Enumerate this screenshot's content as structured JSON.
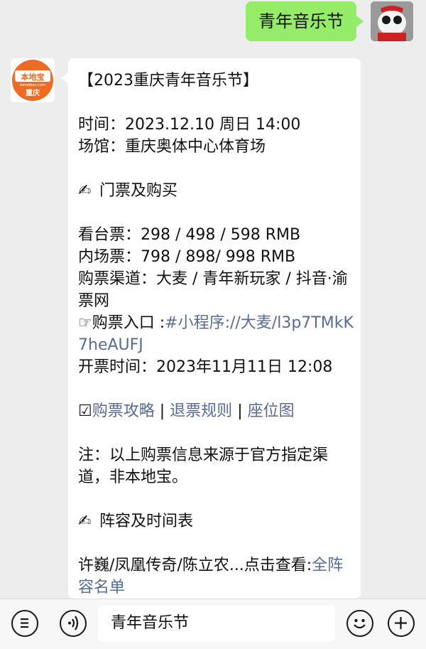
{
  "chat": {
    "outgoing_text": "青年音乐节",
    "bot_logo_text": "本地宝",
    "bot_logo_sub": "bendibao.com",
    "bot_logo_city": "重庆",
    "lines": {
      "title": "【2023重庆青年音乐节】",
      "time": "时间：2023.12.10 周日 14:00",
      "venue": "场馆：重庆奥体中心体育场",
      "tickets_heading": "门票及购买",
      "stand": "看台票：298 / 498 / 598 RMB",
      "floor": "内场票：798 / 898/ 998 RMB",
      "channels": "购票渠道：大麦 / 青年新玩家 / 抖音·渝票网",
      "entry_prefix": "购票入口 :",
      "entry_link": "#小程序://大麦/l3p7TMkK7heAUFJ",
      "open_time": "开票时间：2023年11月11日 12:08",
      "guide_link": "购票攻略",
      "refund_link": "退票规则",
      "seat_link": "座位图",
      "separator": "|",
      "note": "注：以上购票信息来源于官方指定渠道，非本地宝。",
      "lineup_heading": "阵容及时间表",
      "lineup_text": "许巍/凤凰传奇/陈立农...点击查看:",
      "lineup_link": "全阵容名单"
    }
  },
  "input": {
    "value": "青年音乐节"
  },
  "icons": {
    "menu": "menu-icon",
    "voice": "voice-icon",
    "emoji": "emoji-icon",
    "plus": "plus-icon",
    "pen": "writing-hand-icon",
    "check": "checkbox-icon",
    "point": "pointing-hand-icon"
  },
  "colors": {
    "outgoing_bubble": "#95ec69",
    "link": "#576b95",
    "logo_orange": "#ef6a22"
  }
}
